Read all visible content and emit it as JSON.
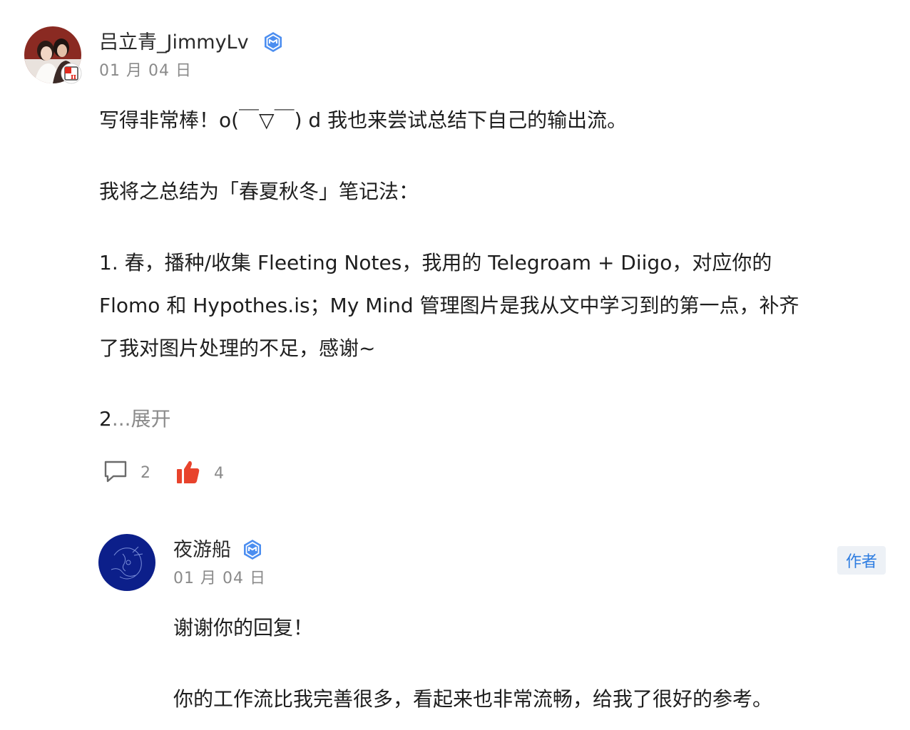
{
  "comment": {
    "user": {
      "name": "吕立青_JimmyLv",
      "date": "01 月 04 日",
      "verified_icon": "verified-badge-icon"
    },
    "paragraphs": [
      "写得非常棒！o(￣▽￣) d 我也来尝试总结下自己的输出流。",
      "我将之总结为「春夏秋冬」笔记法：",
      "1. 春，播种/收集 Fleeting Notes，我用的 Telegroam + Diigo，对应你的",
      "Flomo 和 Hypothes.is；My Mind 管理图片是我从文中学习到的第一点，补齐",
      "了我对图片处理的不足，感谢~"
    ],
    "truncated_prefix": "2",
    "expand_label": "...展开",
    "actions": {
      "reply_count": "2",
      "like_count": "4"
    }
  },
  "reply": {
    "user": {
      "name": "夜游船",
      "date": "01 月 04 日",
      "verified_icon": "verified-badge-icon"
    },
    "author_badge": "作者",
    "paragraphs": [
      "谢谢你的回复！",
      "你的工作流比我完善很多，看起来也非常流畅，给我了很好的参考。"
    ]
  },
  "colors": {
    "accent_blue": "#2e7de1",
    "like_red": "#e8432c",
    "muted_text": "#8a8a8a"
  }
}
